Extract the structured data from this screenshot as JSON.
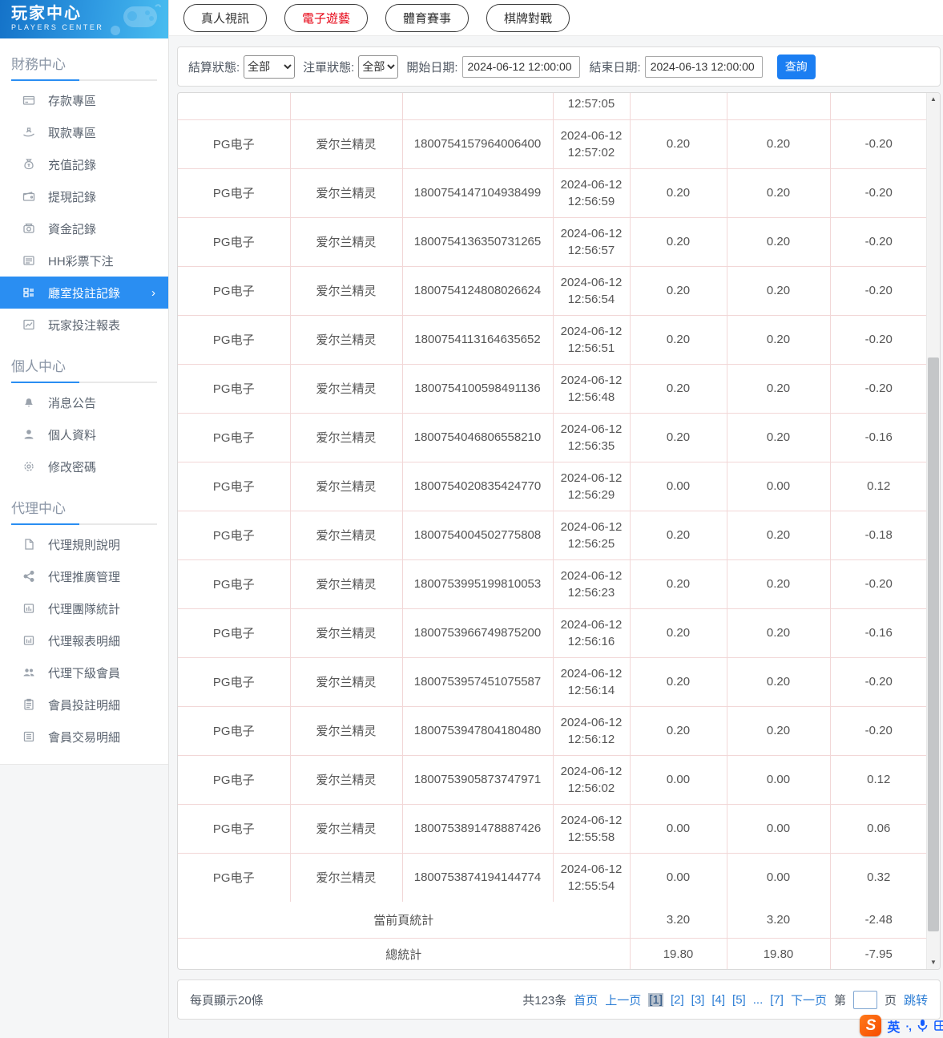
{
  "sidebar": {
    "title": "玩家中心",
    "subtitle": "PLAYERS CENTER",
    "sections": [
      {
        "title": "財務中心",
        "items": [
          {
            "label": "存款專區"
          },
          {
            "label": "取款專區"
          },
          {
            "label": "充值記錄"
          },
          {
            "label": "提現記錄"
          },
          {
            "label": "資金記錄"
          },
          {
            "label": "HH彩票下注"
          },
          {
            "label": "廳室投註記錄"
          },
          {
            "label": "玩家投注報表"
          }
        ]
      },
      {
        "title": "個人中心",
        "items": [
          {
            "label": "消息公告"
          },
          {
            "label": "個人資料"
          },
          {
            "label": "修改密碼"
          }
        ]
      },
      {
        "title": "代理中心",
        "items": [
          {
            "label": "代理規則說明"
          },
          {
            "label": "代理推廣管理"
          },
          {
            "label": "代理團隊統計"
          },
          {
            "label": "代理報表明細"
          },
          {
            "label": "代理下級會員"
          },
          {
            "label": "會員投註明細"
          },
          {
            "label": "會員交易明細"
          }
        ]
      }
    ],
    "active_item": "廳室投註記錄",
    "active_chevron": "›"
  },
  "tabs": {
    "live": "真人視訊",
    "slots": "電子遊藝",
    "sports": "體育賽事",
    "cards": "棋牌對戰",
    "active": "電子遊藝"
  },
  "filters": {
    "settle_label": "結算狀態:",
    "settle_value": "全部",
    "order_label": "注單狀態:",
    "order_value": "全部",
    "start_label": "開始日期:",
    "start_value": "2024-06-12 12:00:00",
    "end_label": "結束日期:",
    "end_value": "2024-06-13 12:00:00",
    "search_label": "查詢"
  },
  "table": {
    "partial_row_time": "12:57:05",
    "rows": [
      {
        "game": "PG电子",
        "name": "爱尔兰精灵",
        "bet_id": "1800754157964006400",
        "date": "2024-06-12",
        "time": "12:57:02",
        "bet": "0.20",
        "valid": "0.20",
        "win": "-0.20"
      },
      {
        "game": "PG电子",
        "name": "爱尔兰精灵",
        "bet_id": "1800754147104938499",
        "date": "2024-06-12",
        "time": "12:56:59",
        "bet": "0.20",
        "valid": "0.20",
        "win": "-0.20"
      },
      {
        "game": "PG电子",
        "name": "爱尔兰精灵",
        "bet_id": "1800754136350731265",
        "date": "2024-06-12",
        "time": "12:56:57",
        "bet": "0.20",
        "valid": "0.20",
        "win": "-0.20"
      },
      {
        "game": "PG电子",
        "name": "爱尔兰精灵",
        "bet_id": "1800754124808026624",
        "date": "2024-06-12",
        "time": "12:56:54",
        "bet": "0.20",
        "valid": "0.20",
        "win": "-0.20"
      },
      {
        "game": "PG电子",
        "name": "爱尔兰精灵",
        "bet_id": "1800754113164635652",
        "date": "2024-06-12",
        "time": "12:56:51",
        "bet": "0.20",
        "valid": "0.20",
        "win": "-0.20"
      },
      {
        "game": "PG电子",
        "name": "爱尔兰精灵",
        "bet_id": "1800754100598491136",
        "date": "2024-06-12",
        "time": "12:56:48",
        "bet": "0.20",
        "valid": "0.20",
        "win": "-0.20"
      },
      {
        "game": "PG电子",
        "name": "爱尔兰精灵",
        "bet_id": "1800754046806558210",
        "date": "2024-06-12",
        "time": "12:56:35",
        "bet": "0.20",
        "valid": "0.20",
        "win": "-0.16"
      },
      {
        "game": "PG电子",
        "name": "爱尔兰精灵",
        "bet_id": "1800754020835424770",
        "date": "2024-06-12",
        "time": "12:56:29",
        "bet": "0.00",
        "valid": "0.00",
        "win": "0.12"
      },
      {
        "game": "PG电子",
        "name": "爱尔兰精灵",
        "bet_id": "1800754004502775808",
        "date": "2024-06-12",
        "time": "12:56:25",
        "bet": "0.20",
        "valid": "0.20",
        "win": "-0.18"
      },
      {
        "game": "PG电子",
        "name": "爱尔兰精灵",
        "bet_id": "1800753995199810053",
        "date": "2024-06-12",
        "time": "12:56:23",
        "bet": "0.20",
        "valid": "0.20",
        "win": "-0.20"
      },
      {
        "game": "PG电子",
        "name": "爱尔兰精灵",
        "bet_id": "1800753966749875200",
        "date": "2024-06-12",
        "time": "12:56:16",
        "bet": "0.20",
        "valid": "0.20",
        "win": "-0.16"
      },
      {
        "game": "PG电子",
        "name": "爱尔兰精灵",
        "bet_id": "1800753957451075587",
        "date": "2024-06-12",
        "time": "12:56:14",
        "bet": "0.20",
        "valid": "0.20",
        "win": "-0.20"
      },
      {
        "game": "PG电子",
        "name": "爱尔兰精灵",
        "bet_id": "1800753947804180480",
        "date": "2024-06-12",
        "time": "12:56:12",
        "bet": "0.20",
        "valid": "0.20",
        "win": "-0.20"
      },
      {
        "game": "PG电子",
        "name": "爱尔兰精灵",
        "bet_id": "1800753905873747971",
        "date": "2024-06-12",
        "time": "12:56:02",
        "bet": "0.00",
        "valid": "0.00",
        "win": "0.12"
      },
      {
        "game": "PG电子",
        "name": "爱尔兰精灵",
        "bet_id": "1800753891478887426",
        "date": "2024-06-12",
        "time": "12:55:58",
        "bet": "0.00",
        "valid": "0.00",
        "win": "0.06"
      },
      {
        "game": "PG电子",
        "name": "爱尔兰精灵",
        "bet_id": "1800753874194144774",
        "date": "2024-06-12",
        "time": "12:55:54",
        "bet": "0.00",
        "valid": "0.00",
        "win": "0.32"
      }
    ],
    "summary_page": {
      "label": "當前頁統計",
      "bet": "3.20",
      "valid": "3.20",
      "win": "-2.48"
    },
    "summary_total": {
      "label": "總統計",
      "bet": "19.80",
      "valid": "19.80",
      "win": "-7.95"
    }
  },
  "pagination": {
    "page_size_text": "每頁顯示20條",
    "total_text": "共123条",
    "first": "首页",
    "prev": "上一页",
    "p1": "[1]",
    "p2": "[2]",
    "p3": "[3]",
    "p4": "[4]",
    "p5": "[5]",
    "ellipsis": "...",
    "p7": "[7]",
    "next": "下一页",
    "goto_prefix": "第",
    "goto_suffix": "页",
    "goto_button": "跳转",
    "current_page": "1"
  },
  "ime": {
    "lang": "英",
    "punct": "·,"
  },
  "colors": {
    "accent_blue": "#2a8ef2",
    "button_blue": "#1b7ef2",
    "tab_active_red": "#e60012",
    "table_border_pink": "#f2d7d7",
    "link_blue": "#2a7cd4",
    "header_gradient_start": "#1472c8",
    "header_gradient_end": "#49bdf0"
  }
}
